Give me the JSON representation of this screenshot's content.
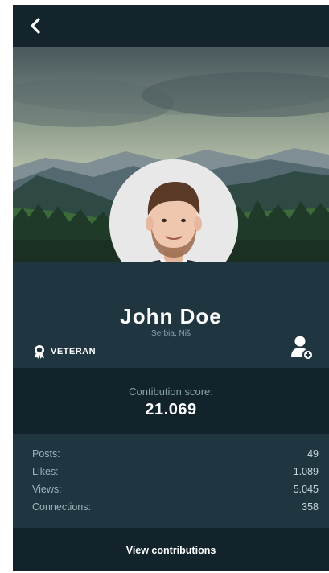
{
  "header": {
    "back_icon": "chevron-left-icon"
  },
  "profile": {
    "name": "John Doe",
    "location": "Serbia, Niš",
    "badge_label": "VETERAN",
    "badge_icon": "award-ribbon-icon",
    "add_user_icon": "add-user-icon"
  },
  "score": {
    "label": "Contibution score:",
    "value": "21.069"
  },
  "stats": [
    {
      "label": "Posts:",
      "value": "49"
    },
    {
      "label": "Likes:",
      "value": "1.089"
    },
    {
      "label": "Views:",
      "value": "5.045"
    },
    {
      "label": "Connections:",
      "value": "358"
    }
  ],
  "footer": {
    "label": "View contributions"
  },
  "colors": {
    "topbar": "#14242c",
    "panel": "#1f3641",
    "dark_panel": "#13232b",
    "text_muted": "#9cb3bc",
    "tie": "#e8631f"
  }
}
